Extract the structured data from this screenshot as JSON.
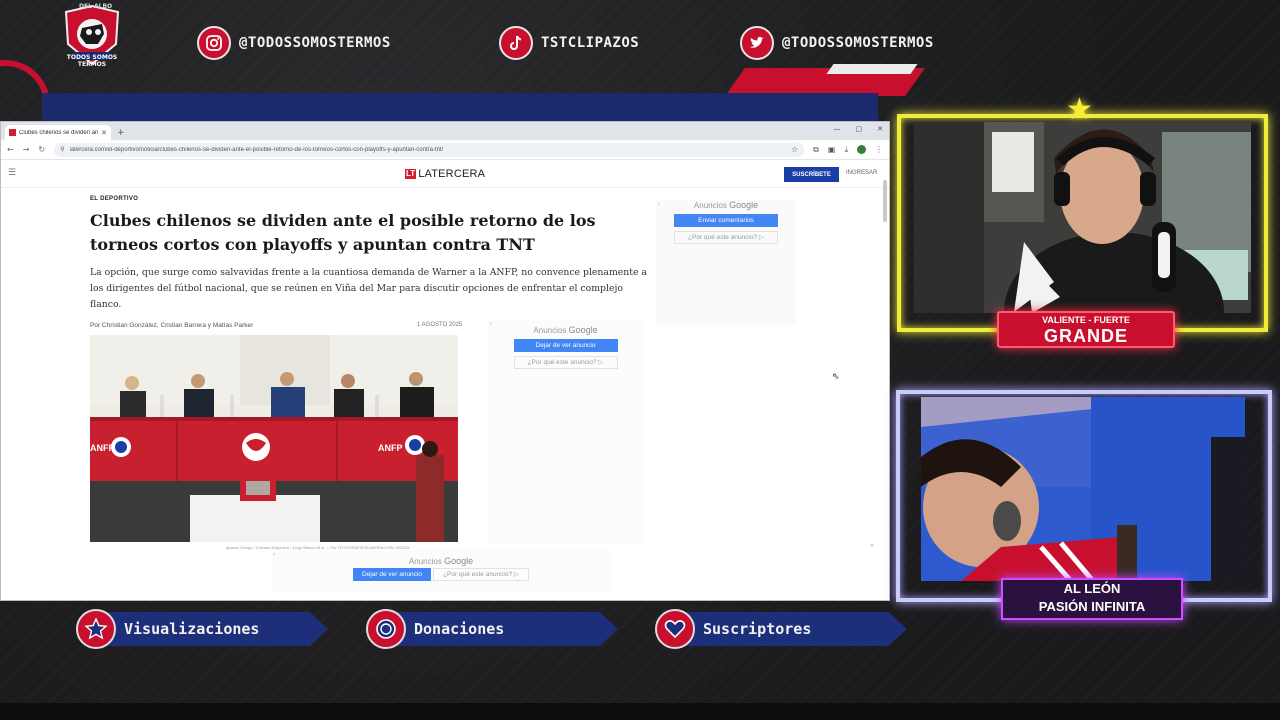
{
  "overlay": {
    "logo": {
      "top_text": "DEL ALBO",
      "bottom_text": "TODOS SOMOS TERMOS"
    },
    "socials": [
      {
        "icon": "instagram-icon",
        "handle": "@TODOSSOMOSTERMOS"
      },
      {
        "icon": "tiktok-icon",
        "handle": "TSTCLIPAZOS"
      },
      {
        "icon": "twitter-icon",
        "handle": "@TODOSSOMOSTERMOS"
      }
    ],
    "stats": [
      {
        "icon": "star-icon",
        "label": "Visualizaciones"
      },
      {
        "icon": "coin-icon",
        "label": "Donaciones"
      },
      {
        "icon": "heart-icon",
        "label": "Suscriptores"
      }
    ],
    "cam1_label": {
      "small": "VALIENTE - FUERTE",
      "big": "GRANDE"
    },
    "cam2_label": {
      "line1": "AL LEÓN",
      "line2": "PASIÓN INFINITA"
    },
    "colors": {
      "accent_red": "#c8102e",
      "navy": "#1d2f7a",
      "neon_yellow": "#f1ec3a",
      "neon_purple": "#c04cff"
    }
  },
  "browser": {
    "tab_title": "Clubes chilenos se dividen ante",
    "url": "latercera.com/el-deportivo/noticia/clubes-chilenos-se-dividen-ante-el-posible-retorno-de-los-torneos-cortos-con-playoffs-y-apuntan-contra-tnt/"
  },
  "site": {
    "brand_mark": "LT",
    "brand_name": "LATERCERA",
    "subscribe": "SUSCRÍBETE",
    "login": "INGRESAR",
    "section": "EL DEPORTIVO",
    "headline": "Clubes chilenos se dividen ante el posible retorno de los torneos cortos con playoffs y apuntan contra TNT",
    "lede": "La opción, que surge como salvavidas frente a la cuantiosa demanda de Warner a la ANFP, no convence plenamente a los dirigentes del fútbol nacional, que se reúnen en Viña del Mar para discutir opciones de enfrentar el complejo flanco.",
    "byline": "Por Christian González, Cristian Barrera y Matías Parker",
    "date": "1 AGOSTO 2025",
    "photo_caption": "Ignacio Orrego / Cronista Deportivo / Jorge Bianco et al — Por FOTOGRAFÍA ELABORACIÓN CEDIDA",
    "photo_banner_text": "ANFP",
    "ads": {
      "label_prefix": "Anuncios",
      "label_google": "Google",
      "right_button": "Enviar comentarios",
      "stop_button": "Dejar de ver anuncio",
      "why": "¿Por qué este anuncio? ▷"
    }
  }
}
